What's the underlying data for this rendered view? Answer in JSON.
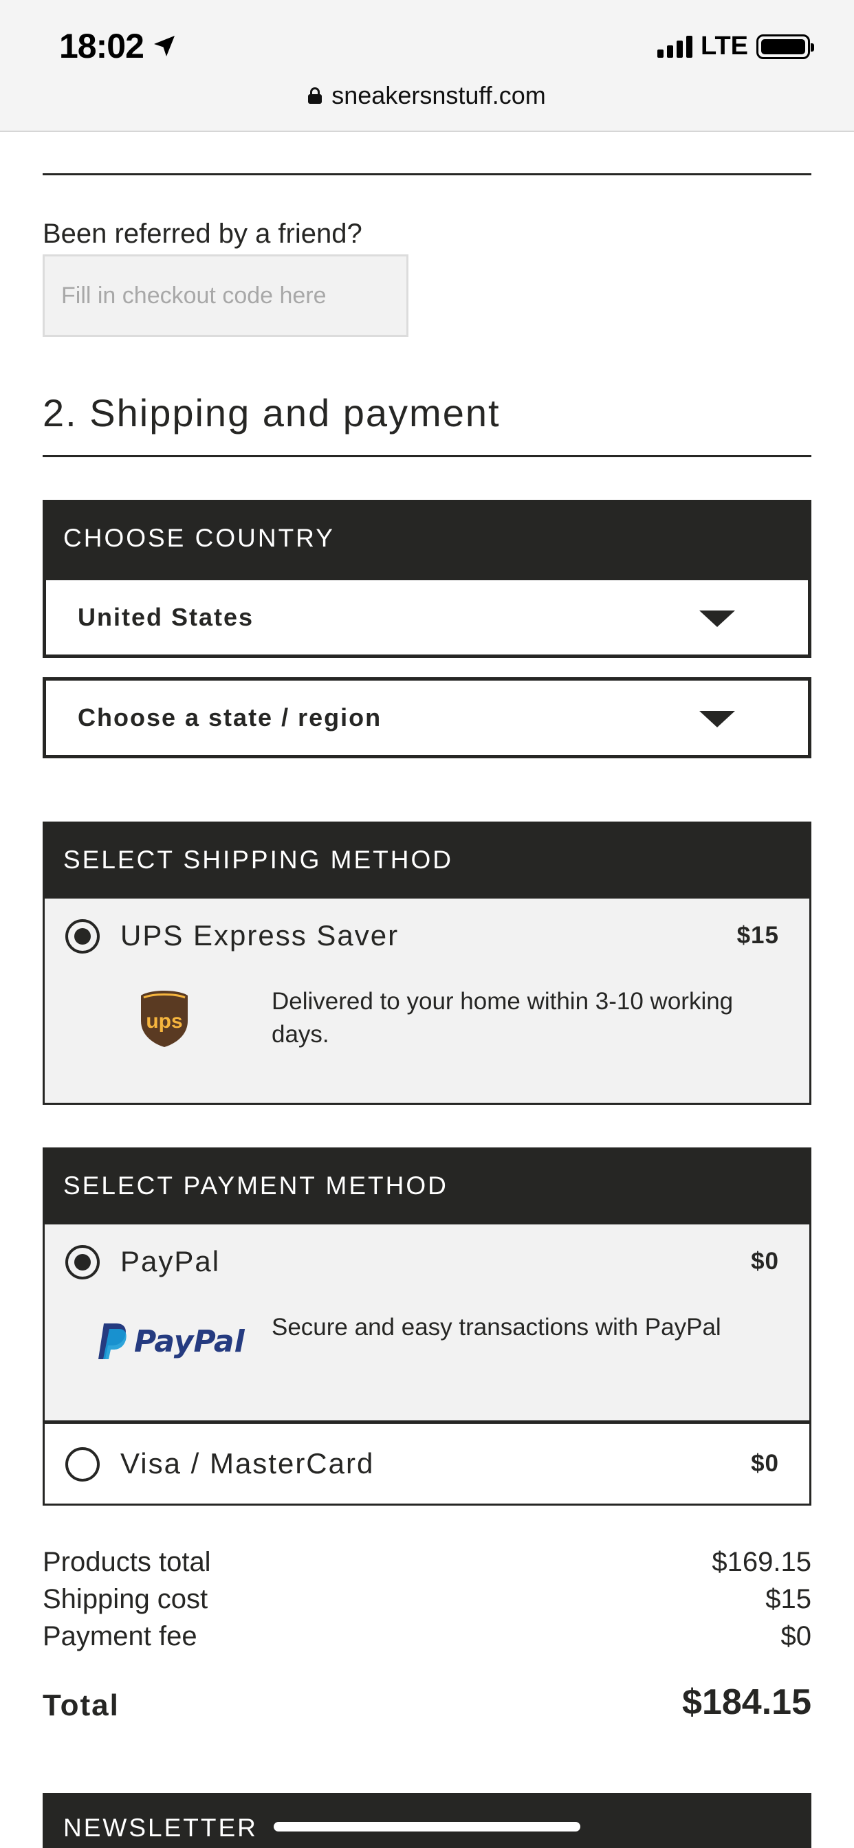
{
  "status_bar": {
    "time": "18:02",
    "network": "LTE"
  },
  "browser": {
    "url": "sneakersnstuff.com"
  },
  "referral": {
    "label": "Been referred by a friend?",
    "placeholder": "Fill in checkout code here"
  },
  "section": {
    "title": "2. Shipping and payment"
  },
  "country": {
    "header": "CHOOSE COUNTRY",
    "selected": "United States",
    "state_placeholder": "Choose a state / region"
  },
  "shipping": {
    "header": "SELECT SHIPPING METHOD",
    "options": [
      {
        "name": "UPS Express Saver",
        "price": "$15",
        "description": "Delivered to your home within 3-10 working days.",
        "logo_text": "ups",
        "selected": true
      }
    ]
  },
  "payment": {
    "header": "SELECT PAYMENT METHOD",
    "options": [
      {
        "name": "PayPal",
        "price": "$0",
        "description": "Secure and easy transactions with PayPal",
        "logo_text": "PayPal",
        "selected": true
      },
      {
        "name": "Visa / MasterCard",
        "price": "$0",
        "selected": false
      }
    ]
  },
  "totals": {
    "products_label": "Products total",
    "products_value": "$169.15",
    "shipping_label": "Shipping cost",
    "shipping_value": "$15",
    "fee_label": "Payment fee",
    "fee_value": "$0",
    "total_label": "Total",
    "total_value": "$184.15"
  },
  "newsletter": {
    "header": "NEWSLETTER"
  },
  "colors": {
    "dark": "#262624",
    "panel": "#f2f2f2",
    "ups_brown": "#5a3a22",
    "ups_gold": "#f6b53e",
    "paypal_dark": "#253b80",
    "paypal_light": "#179bd7"
  }
}
